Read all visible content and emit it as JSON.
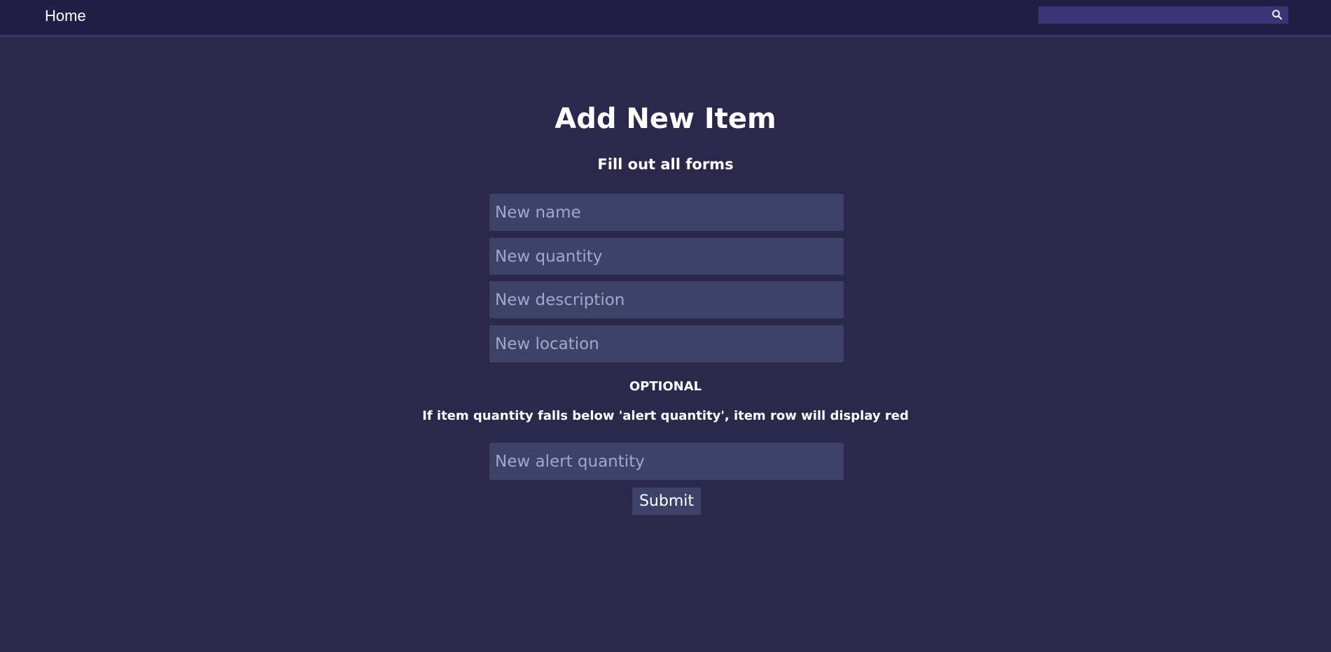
{
  "nav": {
    "home_label": "Home",
    "search_placeholder": "",
    "search_icon": "search-icon"
  },
  "form": {
    "title": "Add New Item",
    "subtitle": "Fill out all forms",
    "fields": {
      "name_placeholder": "New name",
      "quantity_placeholder": "New quantity",
      "description_placeholder": "New description",
      "location_placeholder": "New location",
      "alert_quantity_placeholder": "New alert quantity"
    },
    "optional_label": "OPTIONAL",
    "optional_note": "If item quantity falls below 'alert quantity', item row will display red",
    "submit_label": "Submit"
  },
  "colors": {
    "background": "#2c284c",
    "navbar": "#231f44",
    "accent": "#3b3577",
    "field": "#3e4268"
  }
}
